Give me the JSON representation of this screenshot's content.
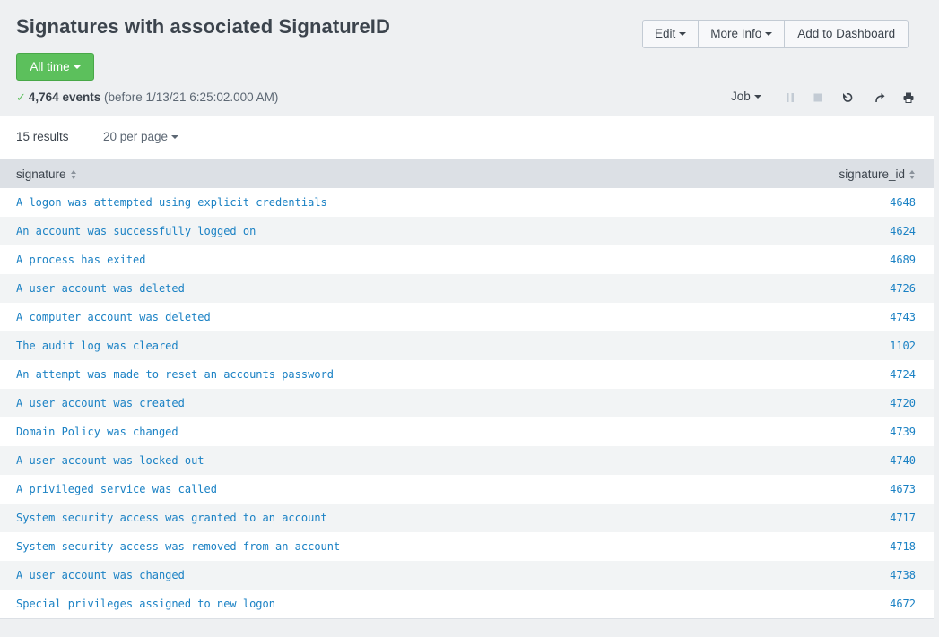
{
  "header": {
    "title": "Signatures with associated SignatureID",
    "buttons": {
      "edit": "Edit",
      "more_info": "More Info",
      "add_to_dashboard": "Add to Dashboard"
    },
    "time_range": "All time",
    "status": {
      "event_count": "4,764 events",
      "before": "(before 1/13/21 6:25:02.000 AM)"
    },
    "job_label": "Job"
  },
  "results": {
    "count_label": "15 results",
    "per_page": "20 per page",
    "columns": [
      "signature",
      "signature_id"
    ],
    "rows": [
      {
        "signature": "A logon was attempted using explicit credentials",
        "signature_id": "4648"
      },
      {
        "signature": "An account was successfully logged on",
        "signature_id": "4624"
      },
      {
        "signature": "A process has exited",
        "signature_id": "4689"
      },
      {
        "signature": "A user account was deleted",
        "signature_id": "4726"
      },
      {
        "signature": "A computer account was deleted",
        "signature_id": "4743"
      },
      {
        "signature": "The audit log was cleared",
        "signature_id": "1102"
      },
      {
        "signature": "An attempt was made to reset an accounts password",
        "signature_id": "4724"
      },
      {
        "signature": "A user account was created",
        "signature_id": "4720"
      },
      {
        "signature": "Domain Policy was changed",
        "signature_id": "4739"
      },
      {
        "signature": "A user account was locked out",
        "signature_id": "4740"
      },
      {
        "signature": "A privileged service was called",
        "signature_id": "4673"
      },
      {
        "signature": "System security access was granted to an account",
        "signature_id": "4717"
      },
      {
        "signature": "System security access was removed from an account",
        "signature_id": "4718"
      },
      {
        "signature": "A user account was changed",
        "signature_id": "4738"
      },
      {
        "signature": "Special privileges assigned to new logon",
        "signature_id": "4672"
      }
    ]
  },
  "icons": {
    "status": "check-icon",
    "controls": [
      "pause-icon",
      "stop-icon",
      "refresh-icon",
      "share-icon",
      "print-icon"
    ]
  },
  "colors": {
    "accent_green": "#5cc05c",
    "link_blue": "#1a81c4",
    "header_bg": "#eef0f2"
  }
}
